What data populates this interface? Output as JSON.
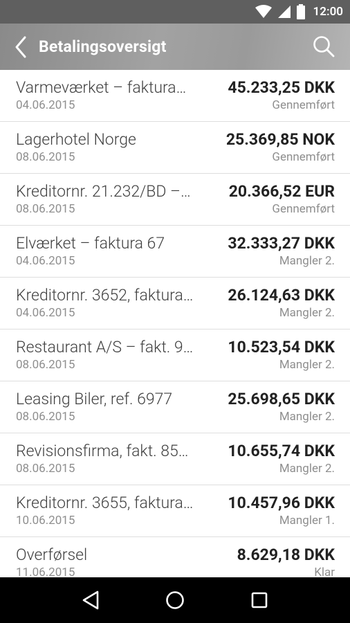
{
  "status_bar": {
    "time": "12:00"
  },
  "toolbar": {
    "title": "Betalingsoversigt"
  },
  "payments": [
    {
      "name": "Varmeværket – faktura…",
      "date": "04.06.2015",
      "amount": "45.233,25 DKK",
      "status": "Gennemført"
    },
    {
      "name": "Lagerhotel Norge",
      "date": "08.06.2015",
      "amount": "25.369,85 NOK",
      "status": "Gennemført"
    },
    {
      "name": "Kreditornr. 21.232/BD –…",
      "date": "08.06.2015",
      "amount": "20.366,52 EUR",
      "status": "Gennemført"
    },
    {
      "name": "Elværket – faktura 67",
      "date": "04.06.2015",
      "amount": "32.333,27 DKK",
      "status": "Mangler 2."
    },
    {
      "name": "Kreditornr. 3652, faktura…",
      "date": "04.06.2015",
      "amount": "26.124,63 DKK",
      "status": "Mangler 2."
    },
    {
      "name": "Restaurant A/S – fakt. 9…",
      "date": "08.06.2015",
      "amount": "10.523,54 DKK",
      "status": "Mangler 2."
    },
    {
      "name": "Leasing Biler, ref. 6977",
      "date": "08.06.2015",
      "amount": "25.698,65 DKK",
      "status": "Mangler 2."
    },
    {
      "name": "Revisionsfirma, fakt. 85…",
      "date": "08.06.2015",
      "amount": "10.655,74 DKK",
      "status": "Mangler 2."
    },
    {
      "name": "Kreditornr. 3655, faktura…",
      "date": "10.06.2015",
      "amount": "10.457,96 DKK",
      "status": "Mangler 1."
    },
    {
      "name": "Overførsel",
      "date": "11.06.2015",
      "amount": "8.629,18 DKK",
      "status": "Klar"
    }
  ]
}
